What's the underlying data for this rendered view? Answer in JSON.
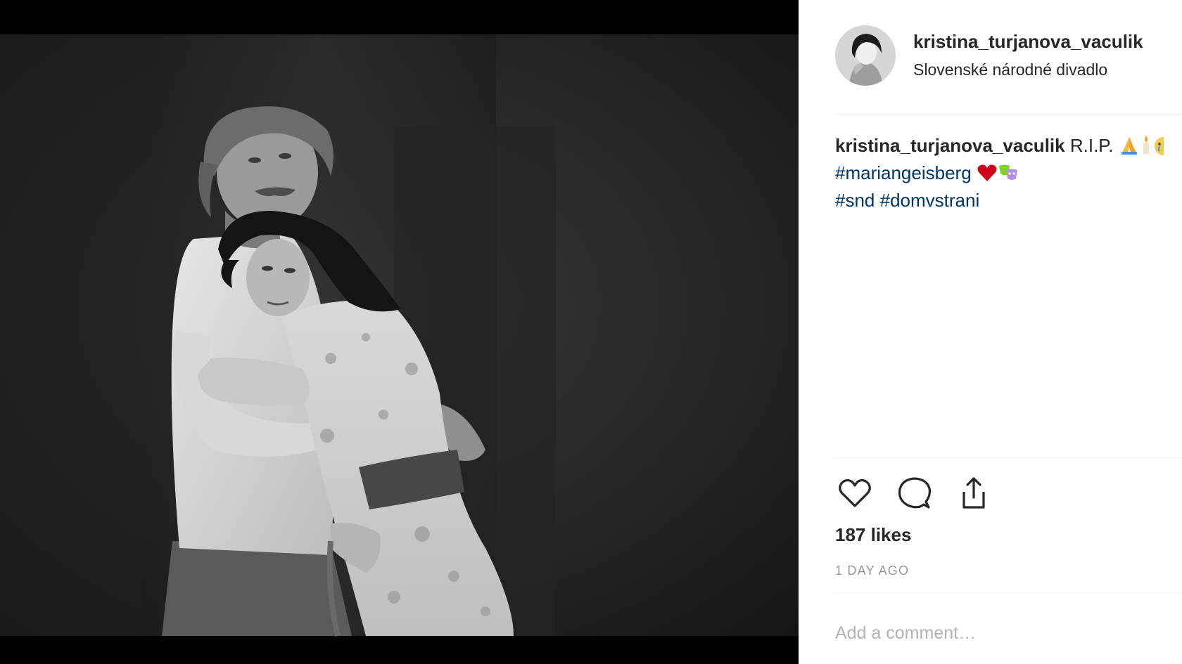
{
  "post": {
    "photo": {
      "icon": "stage-photo-image"
    },
    "header": {
      "avatar_icon": "avatar-image",
      "username": "kristina_turjanova_vaculik",
      "separator": "•",
      "location": "Slovenské národné divadlo"
    },
    "caption": {
      "author": "kristina_turjanova_vaculik",
      "text": "R.I.P.",
      "tags_line1": [
        "#mariangeisberg"
      ],
      "tags_line2": [
        "#snd",
        "#domvstrani"
      ],
      "emojis": [
        "folded-hands-emoji",
        "candle-emoji",
        "crying-face-emoji",
        "red-heart-emoji",
        "performing-arts-emoji"
      ]
    },
    "actions": {
      "like_icon": "heart-icon",
      "comment_icon": "comment-bubble-icon",
      "share_icon": "share-icon"
    },
    "likes": "187 likes",
    "timestamp": "1 DAY AGO",
    "comment": {
      "placeholder": "Add a comment…"
    }
  },
  "colors": {
    "text": "#262626",
    "hashtag": "#003569",
    "muted": "#999999",
    "divider": "#efefef",
    "follow_accent": "#3897f0"
  }
}
